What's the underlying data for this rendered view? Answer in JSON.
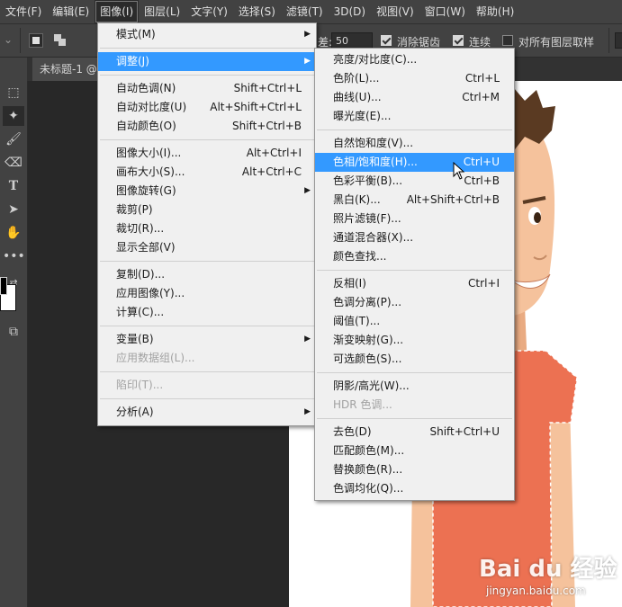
{
  "menubar": {
    "items": [
      "文件(F)",
      "编辑(E)",
      "图像(I)",
      "图层(L)",
      "文字(Y)",
      "选择(S)",
      "滤镜(T)",
      "3D(D)",
      "视图(V)",
      "窗口(W)",
      "帮助(H)"
    ]
  },
  "options": {
    "tolerance_label_partial": "差:",
    "tolerance_value": "50",
    "antialias_label": "消除锯齿",
    "contiguous_label": "连续",
    "all_layers_label": "对所有图层取样"
  },
  "document": {
    "tab_title": "未标题-1 @"
  },
  "image_menu": [
    {
      "label": "模式(M)",
      "submenu": true
    },
    {
      "sep": true
    },
    {
      "label": "调整(J)",
      "submenu": true,
      "highlight": true
    },
    {
      "sep": true
    },
    {
      "label": "自动色调(N)",
      "shortcut": "Shift+Ctrl+L"
    },
    {
      "label": "自动对比度(U)",
      "shortcut": "Alt+Shift+Ctrl+L"
    },
    {
      "label": "自动颜色(O)",
      "shortcut": "Shift+Ctrl+B"
    },
    {
      "sep": true
    },
    {
      "label": "图像大小(I)...",
      "shortcut": "Alt+Ctrl+I"
    },
    {
      "label": "画布大小(S)...",
      "shortcut": "Alt+Ctrl+C"
    },
    {
      "label": "图像旋转(G)",
      "submenu": true
    },
    {
      "label": "裁剪(P)"
    },
    {
      "label": "裁切(R)..."
    },
    {
      "label": "显示全部(V)"
    },
    {
      "sep": true
    },
    {
      "label": "复制(D)..."
    },
    {
      "label": "应用图像(Y)..."
    },
    {
      "label": "计算(C)..."
    },
    {
      "sep": true
    },
    {
      "label": "变量(B)",
      "submenu": true
    },
    {
      "label": "应用数据组(L)...",
      "disabled": true
    },
    {
      "sep": true
    },
    {
      "label": "陷印(T)...",
      "disabled": true
    },
    {
      "sep": true
    },
    {
      "label": "分析(A)",
      "submenu": true
    }
  ],
  "adjust_menu": [
    {
      "label": "亮度/对比度(C)..."
    },
    {
      "label": "色阶(L)...",
      "shortcut": "Ctrl+L"
    },
    {
      "label": "曲线(U)...",
      "shortcut": "Ctrl+M"
    },
    {
      "label": "曝光度(E)..."
    },
    {
      "sep": true
    },
    {
      "label": "自然饱和度(V)..."
    },
    {
      "label": "色相/饱和度(H)...",
      "shortcut": "Ctrl+U",
      "highlight": true
    },
    {
      "label": "色彩平衡(B)...",
      "shortcut": "Ctrl+B"
    },
    {
      "label": "黑白(K)...",
      "shortcut": "Alt+Shift+Ctrl+B"
    },
    {
      "label": "照片滤镜(F)..."
    },
    {
      "label": "通道混合器(X)..."
    },
    {
      "label": "颜色查找..."
    },
    {
      "sep": true
    },
    {
      "label": "反相(I)",
      "shortcut": "Ctrl+I"
    },
    {
      "label": "色调分离(P)..."
    },
    {
      "label": "阈值(T)..."
    },
    {
      "label": "渐变映射(G)..."
    },
    {
      "label": "可选颜色(S)..."
    },
    {
      "sep": true
    },
    {
      "label": "阴影/高光(W)..."
    },
    {
      "label": "HDR 色调...",
      "disabled": true
    },
    {
      "sep": true
    },
    {
      "label": "去色(D)",
      "shortcut": "Shift+Ctrl+U"
    },
    {
      "label": "匹配颜色(M)..."
    },
    {
      "label": "替换颜色(R)..."
    },
    {
      "label": "色调均化(Q)..."
    }
  ],
  "watermark": {
    "logo": "Bai du 经验",
    "url": "jingyan.baidu.com"
  },
  "colors": {
    "highlight": "#3399ff",
    "shirt": "#ec7152",
    "skin": "#f5c29c",
    "hair": "#5a3a22"
  }
}
